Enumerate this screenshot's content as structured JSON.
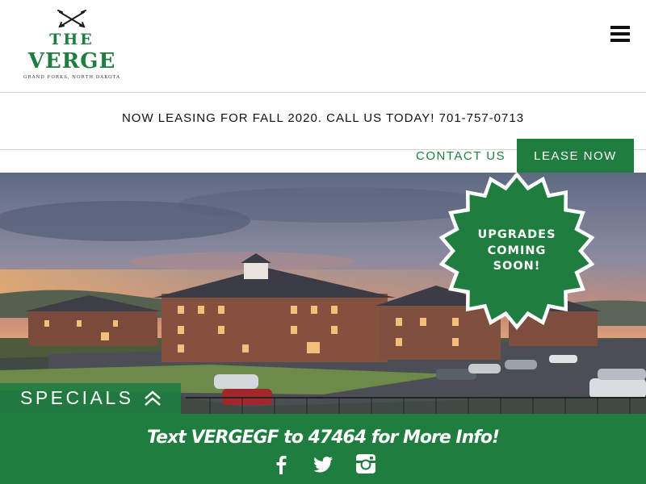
{
  "brand": {
    "name_line1": "THE",
    "name_line2": "VERGE",
    "tagline": "GRAND FORKS, NORTH DAKOTA",
    "color": "#1f7d3f"
  },
  "header": {
    "menu_icon": "hamburger-menu-icon",
    "announcement": "NOW LEASING FOR FALL 2020. CALL US TODAY! 701-757-0713"
  },
  "nav": {
    "contact_label": "CONTACT US",
    "lease_label": "LEASE NOW"
  },
  "hero": {
    "image": "apartment-complex-at-sunset",
    "badge_text_line1": "UPGRADES",
    "badge_text_line2": "COMING",
    "badge_text_line3": "SOON!"
  },
  "specials": {
    "label": "SPECIALS",
    "icon": "double-chevron-up-icon"
  },
  "text_banner": {
    "text": "Text VERGEGF to 47464 for More Info!"
  },
  "footer": {
    "social": [
      {
        "name": "facebook",
        "icon": "facebook-icon"
      },
      {
        "name": "twitter",
        "icon": "twitter-icon"
      },
      {
        "name": "instagram",
        "icon": "instagram-icon"
      }
    ]
  }
}
